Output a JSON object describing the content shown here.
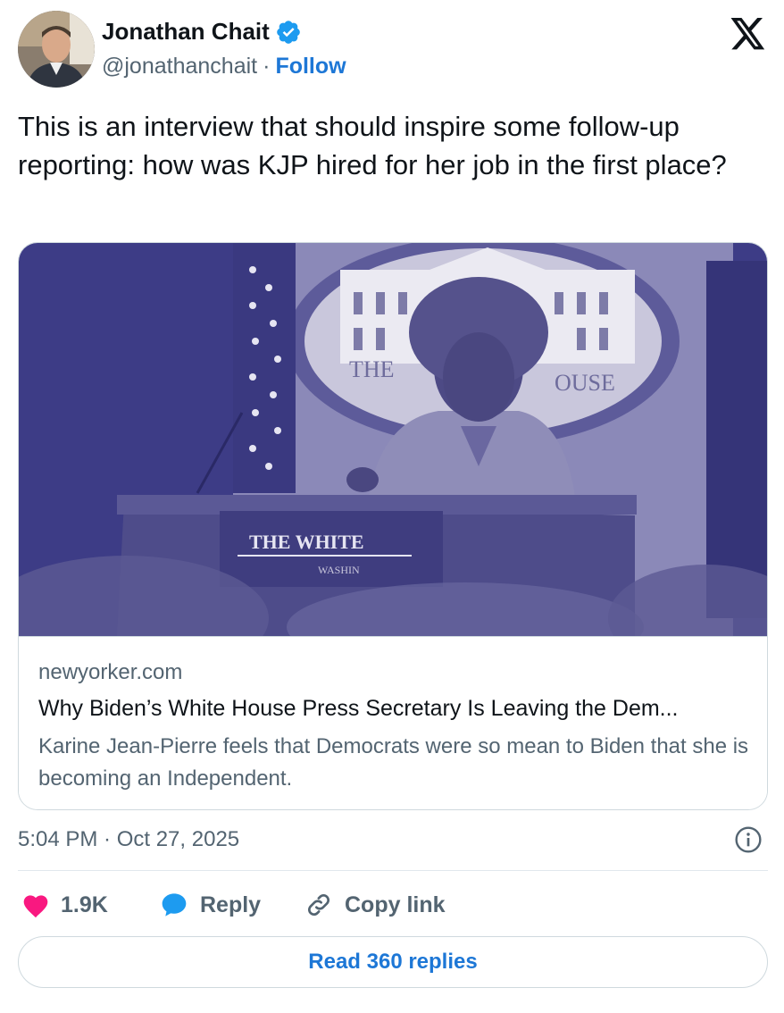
{
  "author": {
    "name": "Jonathan Chait",
    "handle": "@jonathanchait",
    "separator": "·",
    "follow_label": "Follow",
    "verified": true
  },
  "tweet": {
    "text": "This is an interview that should inspire some follow-up reporting: how was KJP hired for her job in the first place?"
  },
  "card": {
    "domain": "newyorker.com",
    "title": "Why Biden’s White House Press Secretary Is Leaving the Dem...",
    "description": "Karine Jean-Pierre feels that Democrats were so mean to Biden that she is becoming an Independent.",
    "image_text": {
      "podium_line1": "THE WHITE",
      "podium_line2": "WASHIN",
      "seal_left": "THE",
      "seal_right": "OUSE"
    }
  },
  "meta": {
    "timestamp": "5:04 PM · Oct 27, 2025"
  },
  "actions": {
    "like_count": "1.9K",
    "reply_label": "Reply",
    "copy_label": "Copy link"
  },
  "footer": {
    "read_replies_label": "Read 360 replies"
  },
  "colors": {
    "accent": "#1d77d6",
    "like": "#f91880",
    "reply_icon": "#1d9bf0",
    "verified": "#1d9bf0",
    "secondary_text": "#536471",
    "image_tint": "#3d3c86"
  },
  "icons": [
    "x-logo-icon",
    "verified-badge-icon",
    "heart-icon",
    "reply-bubble-icon",
    "link-icon",
    "info-icon"
  ]
}
